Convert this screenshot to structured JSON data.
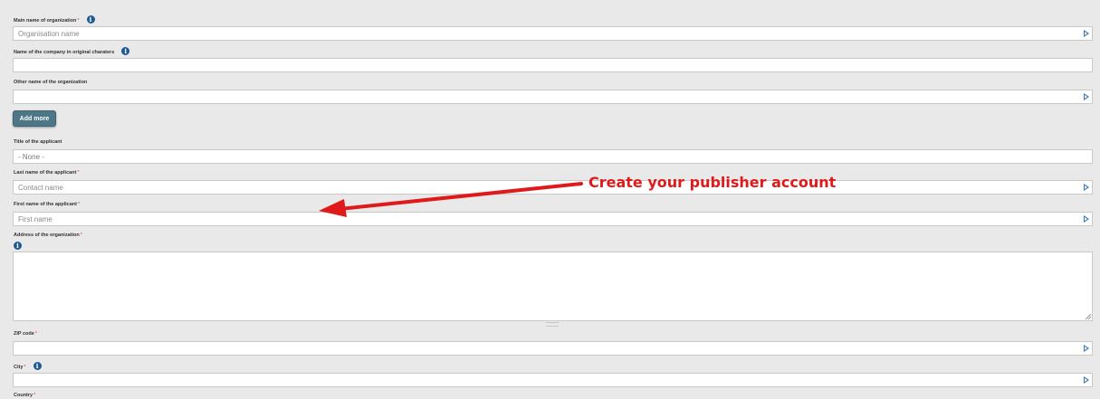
{
  "form": {
    "main_name": {
      "label": "Main name of organization",
      "required_mark": "*",
      "placeholder": "Organisation name"
    },
    "original_name": {
      "label": "Name of the company in original charaters"
    },
    "other_name": {
      "label": "Other name of the organization"
    },
    "add_more_label": "Add more",
    "title": {
      "label": "Title of the applicant",
      "value": "- None -"
    },
    "last_name": {
      "label": "Last name of the applicant",
      "required_mark": "*",
      "placeholder": "Contact name"
    },
    "first_name": {
      "label": "First name of the applicant",
      "required_mark": "*",
      "placeholder": "First name"
    },
    "address": {
      "label": "Address of the organization",
      "required_mark": "*"
    },
    "zip": {
      "label": "ZIP code",
      "required_mark": "*"
    },
    "city": {
      "label": "City",
      "required_mark": "*"
    },
    "country": {
      "label": "Country",
      "required_mark": "*"
    }
  },
  "info_icon_glyph": "i",
  "annotation": {
    "text": "Create your publisher account",
    "color": "#e01a1a"
  },
  "colors": {
    "info_icon": "#1f5a92",
    "button_bg": "#4d7787",
    "arrow_icon": "#3a78b8",
    "required": "#dd3333"
  },
  "icons": {
    "info": "info-icon",
    "field_action": "play-arrow-icon"
  }
}
